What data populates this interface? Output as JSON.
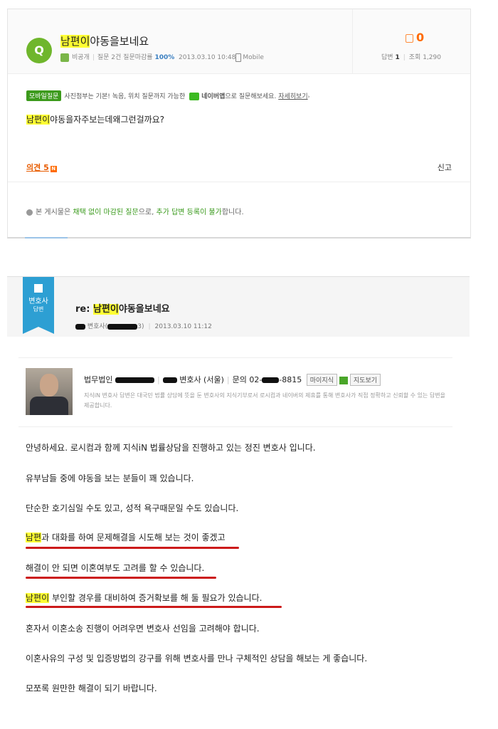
{
  "question": {
    "icon_label": "Q",
    "title_highlight": "남편이",
    "title_rest": "야동을보네요",
    "author": "비공개",
    "stats": "질문 2건 질문마감률",
    "rate": "100%",
    "datetime": "2013.03.10 10:48",
    "device": "Mobile",
    "thumbs": "0",
    "answers_label": "답변",
    "answers_count": "1",
    "views_label": "조회",
    "views_count": "1,290",
    "mobile_tag": "모바일질문",
    "mobile_text": "사진첨부는 기본! 녹음, 위치 질문까지 가능한",
    "naver_app": "네이버앱",
    "mobile_text2": "으로 질문해보세요.",
    "more_link": "자세히보기",
    "body_highlight": "남편이",
    "body_rest": "야동을자주보는데왜그런걸까요?",
    "opinion": "의견 5",
    "new_badge": "N",
    "report": "신고",
    "notice_pre": "본 게시물은",
    "notice_g1": "채택 없이 마감된 질문",
    "notice_mid": "으로,",
    "notice_g2": "추가 답변 등록이 불가",
    "notice_post": "합니다."
  },
  "answer": {
    "tag_line1": "변호사",
    "tag_line2": "답변",
    "title_prefix": "re:",
    "title_highlight": "남편이",
    "title_rest": "야동을보네요",
    "author_tail": "변호사(",
    "author_end": "3)",
    "datetime": "2013.03.10 11:12"
  },
  "lawyer": {
    "firm": "법무법인",
    "title": "변호사 (서울)",
    "contact_label": "문의 02-",
    "contact_end": "-8815",
    "btn_myjisik": "마이지식",
    "btn_map": "지도보기",
    "desc": "지식iN 변호사 답변은 대국민 법률 상담에 뜻을 둔 변호사의 지식기부로서 로시컴과 네이버의 제휴를 통해 변호사가 직접 정확하고 신뢰할 수 있는 답변을 제공합니다."
  },
  "body": {
    "p1": "안녕하세요. 로시컴과 함께 지식iN 법률상담을 진행하고 있는 정진 변호사 입니다.",
    "p2": "유부남들 중에 야동을 보는 분들이 꽤 있습니다.",
    "p3": "단순한 호기심일 수도 있고, 성적 욕구때문일 수도 있습니다.",
    "p4_hl": "남편",
    "p4_rest": "과 대화를 하여 문제해결을 시도해 보는 것이 좋겠고",
    "p5": "해결이 안 되면 이혼여부도 고려를 할 수 있습니다.",
    "p6_hl": "남편이",
    "p6_rest": " 부인할 경우를 대비하여 증거확보를 해 둘 필요가 있습니다.",
    "p7": "혼자서 이혼소송 진행이 어려우면 변호사 선임을 고려해야 합니다.",
    "p8": "이혼사유의 구성 및 입증방법의 강구를 위해 변호사를 만나 구체적인 상담을 해보는 게 좋습니다.",
    "p9": "모쪼록 원만한 해결이 되기 바랍니다."
  },
  "colors": {
    "highlight": "#ffff33",
    "green": "#6fb62c",
    "orange": "#ff6a00",
    "underline": "#cc1a1a",
    "lawyer_blue": "#2d9fd3"
  }
}
